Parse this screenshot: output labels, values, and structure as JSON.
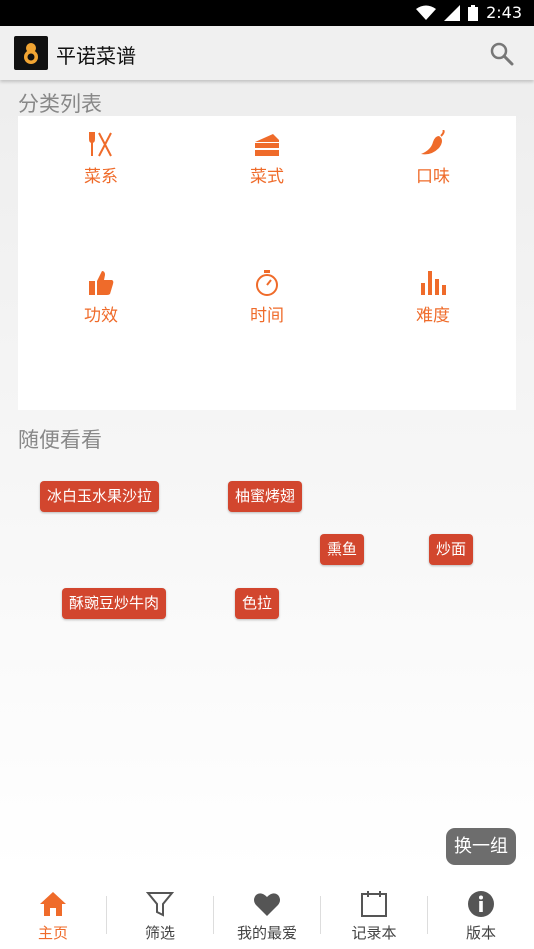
{
  "status_bar": {
    "time": "2:43"
  },
  "app_bar": {
    "title": "平诺菜谱"
  },
  "categories_section": {
    "title": "分类列表",
    "items": [
      {
        "label": "菜系",
        "icon": "utensils-icon"
      },
      {
        "label": "菜式",
        "icon": "cake-icon"
      },
      {
        "label": "口味",
        "icon": "chili-icon"
      },
      {
        "label": "功效",
        "icon": "thumbs-up-icon"
      },
      {
        "label": "时间",
        "icon": "stopwatch-icon"
      },
      {
        "label": "难度",
        "icon": "bar-chart-icon"
      }
    ]
  },
  "random_section": {
    "title": "随便看看",
    "tags": [
      "冰白玉水果沙拉",
      "柚蜜烤翅",
      "熏鱼",
      "炒面",
      "酥豌豆炒牛肉",
      "色拉"
    ],
    "refresh_label": "换一组"
  },
  "bottom_nav": {
    "items": [
      {
        "label": "主页",
        "icon": "home-icon",
        "active": true
      },
      {
        "label": "筛选",
        "icon": "filter-icon",
        "active": false
      },
      {
        "label": "我的最爱",
        "icon": "heart-icon",
        "active": false
      },
      {
        "label": "记录本",
        "icon": "notebook-icon",
        "active": false
      },
      {
        "label": "版本",
        "icon": "info-icon",
        "active": false
      }
    ]
  },
  "colors": {
    "accent": "#ef6b2a",
    "tag": "#d2462e",
    "background": "#f0f0f0"
  }
}
